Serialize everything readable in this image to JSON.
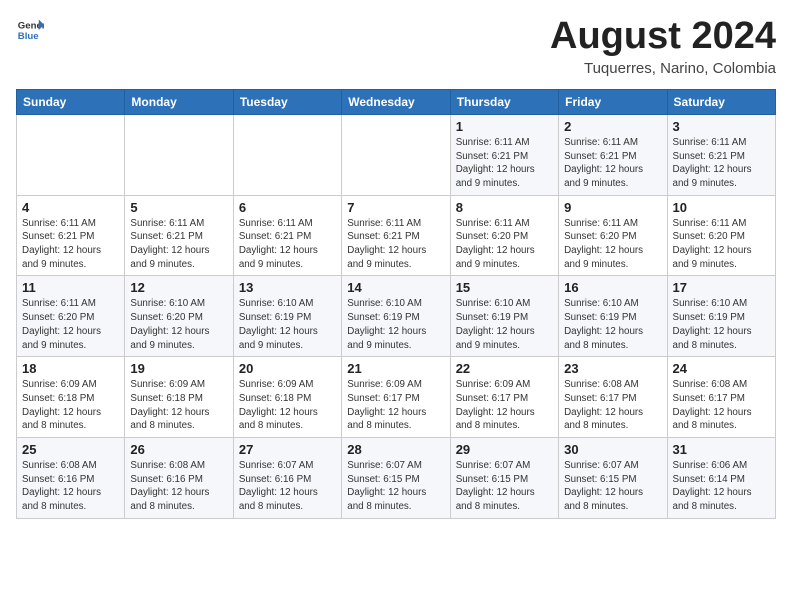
{
  "logo": {
    "general": "General",
    "blue": "Blue"
  },
  "title": "August 2024",
  "subtitle": "Tuquerres, Narino, Colombia",
  "days_of_week": [
    "Sunday",
    "Monday",
    "Tuesday",
    "Wednesday",
    "Thursday",
    "Friday",
    "Saturday"
  ],
  "weeks": [
    [
      {
        "day": "",
        "info": ""
      },
      {
        "day": "",
        "info": ""
      },
      {
        "day": "",
        "info": ""
      },
      {
        "day": "",
        "info": ""
      },
      {
        "day": "1",
        "info": "Sunrise: 6:11 AM\nSunset: 6:21 PM\nDaylight: 12 hours and 9 minutes."
      },
      {
        "day": "2",
        "info": "Sunrise: 6:11 AM\nSunset: 6:21 PM\nDaylight: 12 hours and 9 minutes."
      },
      {
        "day": "3",
        "info": "Sunrise: 6:11 AM\nSunset: 6:21 PM\nDaylight: 12 hours and 9 minutes."
      }
    ],
    [
      {
        "day": "4",
        "info": "Sunrise: 6:11 AM\nSunset: 6:21 PM\nDaylight: 12 hours and 9 minutes."
      },
      {
        "day": "5",
        "info": "Sunrise: 6:11 AM\nSunset: 6:21 PM\nDaylight: 12 hours and 9 minutes."
      },
      {
        "day": "6",
        "info": "Sunrise: 6:11 AM\nSunset: 6:21 PM\nDaylight: 12 hours and 9 minutes."
      },
      {
        "day": "7",
        "info": "Sunrise: 6:11 AM\nSunset: 6:21 PM\nDaylight: 12 hours and 9 minutes."
      },
      {
        "day": "8",
        "info": "Sunrise: 6:11 AM\nSunset: 6:20 PM\nDaylight: 12 hours and 9 minutes."
      },
      {
        "day": "9",
        "info": "Sunrise: 6:11 AM\nSunset: 6:20 PM\nDaylight: 12 hours and 9 minutes."
      },
      {
        "day": "10",
        "info": "Sunrise: 6:11 AM\nSunset: 6:20 PM\nDaylight: 12 hours and 9 minutes."
      }
    ],
    [
      {
        "day": "11",
        "info": "Sunrise: 6:11 AM\nSunset: 6:20 PM\nDaylight: 12 hours and 9 minutes."
      },
      {
        "day": "12",
        "info": "Sunrise: 6:10 AM\nSunset: 6:20 PM\nDaylight: 12 hours and 9 minutes."
      },
      {
        "day": "13",
        "info": "Sunrise: 6:10 AM\nSunset: 6:19 PM\nDaylight: 12 hours and 9 minutes."
      },
      {
        "day": "14",
        "info": "Sunrise: 6:10 AM\nSunset: 6:19 PM\nDaylight: 12 hours and 9 minutes."
      },
      {
        "day": "15",
        "info": "Sunrise: 6:10 AM\nSunset: 6:19 PM\nDaylight: 12 hours and 9 minutes."
      },
      {
        "day": "16",
        "info": "Sunrise: 6:10 AM\nSunset: 6:19 PM\nDaylight: 12 hours and 8 minutes."
      },
      {
        "day": "17",
        "info": "Sunrise: 6:10 AM\nSunset: 6:19 PM\nDaylight: 12 hours and 8 minutes."
      }
    ],
    [
      {
        "day": "18",
        "info": "Sunrise: 6:09 AM\nSunset: 6:18 PM\nDaylight: 12 hours and 8 minutes."
      },
      {
        "day": "19",
        "info": "Sunrise: 6:09 AM\nSunset: 6:18 PM\nDaylight: 12 hours and 8 minutes."
      },
      {
        "day": "20",
        "info": "Sunrise: 6:09 AM\nSunset: 6:18 PM\nDaylight: 12 hours and 8 minutes."
      },
      {
        "day": "21",
        "info": "Sunrise: 6:09 AM\nSunset: 6:17 PM\nDaylight: 12 hours and 8 minutes."
      },
      {
        "day": "22",
        "info": "Sunrise: 6:09 AM\nSunset: 6:17 PM\nDaylight: 12 hours and 8 minutes."
      },
      {
        "day": "23",
        "info": "Sunrise: 6:08 AM\nSunset: 6:17 PM\nDaylight: 12 hours and 8 minutes."
      },
      {
        "day": "24",
        "info": "Sunrise: 6:08 AM\nSunset: 6:17 PM\nDaylight: 12 hours and 8 minutes."
      }
    ],
    [
      {
        "day": "25",
        "info": "Sunrise: 6:08 AM\nSunset: 6:16 PM\nDaylight: 12 hours and 8 minutes."
      },
      {
        "day": "26",
        "info": "Sunrise: 6:08 AM\nSunset: 6:16 PM\nDaylight: 12 hours and 8 minutes."
      },
      {
        "day": "27",
        "info": "Sunrise: 6:07 AM\nSunset: 6:16 PM\nDaylight: 12 hours and 8 minutes."
      },
      {
        "day": "28",
        "info": "Sunrise: 6:07 AM\nSunset: 6:15 PM\nDaylight: 12 hours and 8 minutes."
      },
      {
        "day": "29",
        "info": "Sunrise: 6:07 AM\nSunset: 6:15 PM\nDaylight: 12 hours and 8 minutes."
      },
      {
        "day": "30",
        "info": "Sunrise: 6:07 AM\nSunset: 6:15 PM\nDaylight: 12 hours and 8 minutes."
      },
      {
        "day": "31",
        "info": "Sunrise: 6:06 AM\nSunset: 6:14 PM\nDaylight: 12 hours and 8 minutes."
      }
    ]
  ]
}
